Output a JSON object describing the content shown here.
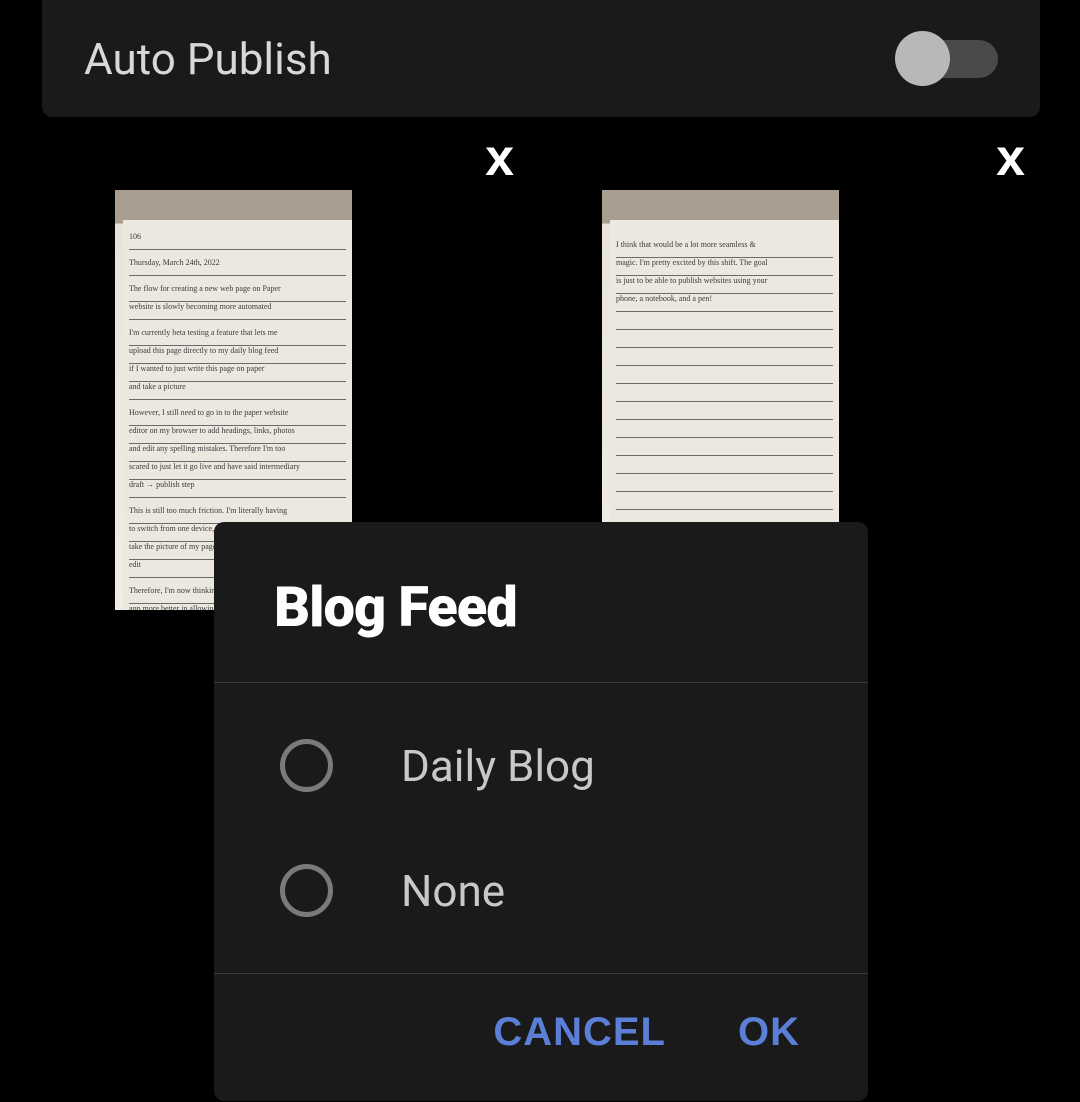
{
  "settings": {
    "autoPublishLabel": "Auto Publish",
    "autoPublishOn": false
  },
  "photos": [
    {
      "closeLabel": "x"
    },
    {
      "closeLabel": "x"
    }
  ],
  "dialog": {
    "title": "Blog Feed",
    "options": [
      {
        "label": "Daily Blog",
        "selected": false
      },
      {
        "label": "None",
        "selected": false
      }
    ],
    "cancelLabel": "CANCEL",
    "okLabel": "OK"
  }
}
